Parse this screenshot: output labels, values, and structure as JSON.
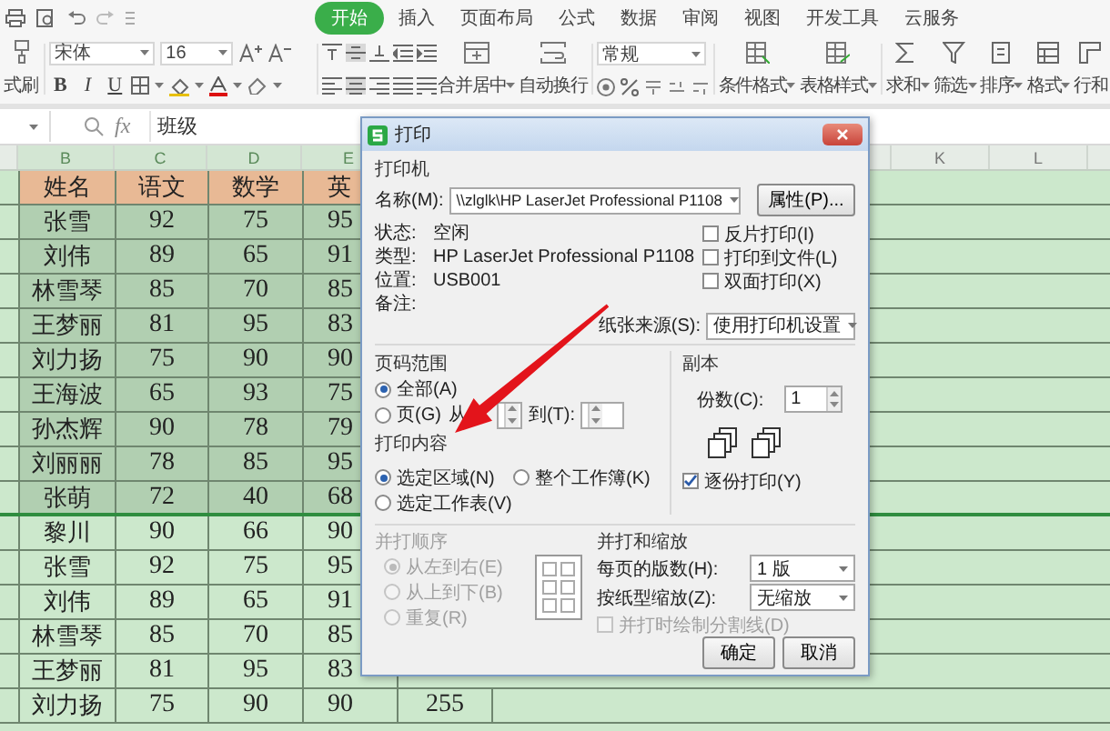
{
  "ribbon": {
    "tabs": [
      {
        "label": "开始",
        "selected": true
      },
      {
        "label": "插入",
        "selected": false
      },
      {
        "label": "页面布局",
        "selected": false
      },
      {
        "label": "公式",
        "selected": false
      },
      {
        "label": "数据",
        "selected": false
      },
      {
        "label": "审阅",
        "selected": false
      },
      {
        "label": "视图",
        "selected": false
      },
      {
        "label": "开发工具",
        "selected": false
      },
      {
        "label": "云服务",
        "selected": false
      }
    ],
    "format_painter": "式刷",
    "font_name": "宋体",
    "font_size": "16",
    "text_styles": [
      "B",
      "I",
      "U"
    ],
    "merge": "合并居中",
    "wrap": "自动换行",
    "number_format": "常规",
    "commands": [
      {
        "label": "条件格式",
        "menu": true
      },
      {
        "label": "表格样式",
        "menu": true
      },
      {
        "label": "求和",
        "menu": true
      },
      {
        "label": "筛选",
        "menu": true
      },
      {
        "label": "排序",
        "menu": true
      },
      {
        "label": "格式",
        "menu": true
      },
      {
        "label": "行和",
        "menu": false
      }
    ]
  },
  "formula_bar": {
    "fx": "fx",
    "value": "班级"
  },
  "sheet": {
    "columns_left": [
      "B",
      "C",
      "D",
      "E"
    ],
    "columns_right": [
      "K",
      "L"
    ],
    "rows": [
      {
        "kind": "header",
        "cells": [
          "姓名",
          "语文",
          "数学",
          "英"
        ]
      },
      {
        "kind": "data",
        "selected": true,
        "cells": [
          "张雪",
          "92",
          "75",
          "95"
        ]
      },
      {
        "kind": "data",
        "selected": true,
        "cells": [
          "刘伟",
          "89",
          "65",
          "91"
        ]
      },
      {
        "kind": "data",
        "selected": true,
        "cells": [
          "林雪琴",
          "85",
          "70",
          "85"
        ]
      },
      {
        "kind": "data",
        "selected": true,
        "cells": [
          "王梦丽",
          "81",
          "95",
          "83"
        ]
      },
      {
        "kind": "data",
        "selected": true,
        "cells": [
          "刘力扬",
          "75",
          "90",
          "90"
        ]
      },
      {
        "kind": "data",
        "selected": true,
        "cells": [
          "王海波",
          "65",
          "93",
          "75"
        ]
      },
      {
        "kind": "data",
        "selected": true,
        "cells": [
          "孙杰辉",
          "90",
          "78",
          "79"
        ]
      },
      {
        "kind": "data",
        "selected": true,
        "cells": [
          "刘丽丽",
          "78",
          "85",
          "95"
        ]
      },
      {
        "kind": "data",
        "selected": true,
        "cells": [
          "张萌",
          "72",
          "40",
          "68"
        ]
      },
      {
        "kind": "data",
        "selected": false,
        "cells": [
          "黎川",
          "90",
          "66",
          "90"
        ]
      },
      {
        "kind": "data",
        "selected": false,
        "cells": [
          "张雪",
          "92",
          "75",
          "95"
        ]
      },
      {
        "kind": "data",
        "selected": false,
        "cells": [
          "刘伟",
          "89",
          "65",
          "91"
        ]
      },
      {
        "kind": "data",
        "selected": false,
        "cells": [
          "林雪琴",
          "85",
          "70",
          "85"
        ]
      },
      {
        "kind": "data",
        "selected": false,
        "cells": [
          "王梦丽",
          "81",
          "95",
          "83"
        ]
      },
      {
        "kind": "data",
        "selected": false,
        "cells": [
          "刘力扬",
          "75",
          "90",
          "90",
          "255"
        ]
      }
    ]
  },
  "print_dialog": {
    "title": "打印",
    "printer": {
      "heading": "打印机",
      "name_label": "名称(M):",
      "name_value": "\\\\zlglk\\HP LaserJet Professional P1108",
      "properties_button": "属性(P)...",
      "info": [
        {
          "label": "状态:",
          "value": "空闲"
        },
        {
          "label": "类型:",
          "value": "HP LaserJet Professional P1108"
        },
        {
          "label": "位置:",
          "value": "USB001"
        },
        {
          "label": "备注:"
        }
      ],
      "options": [
        {
          "label": "反片打印(I)",
          "checked": false
        },
        {
          "label": "打印到文件(L)",
          "checked": false
        },
        {
          "label": "双面打印(X)",
          "checked": false
        }
      ],
      "paper_source": {
        "label": "纸张来源(S):",
        "value": "使用打印机设置"
      }
    },
    "page_range": {
      "heading": "页码范围",
      "options": [
        {
          "label": "全部(A)",
          "selected": true
        },
        {
          "label": "页(G)",
          "selected": false
        }
      ],
      "from_label": "从",
      "to_label": "到(T):"
    },
    "copies": {
      "heading": "副本",
      "count_label": "份数(C):",
      "count": "1",
      "collate": {
        "label": "逐份打印(Y)",
        "checked": true
      }
    },
    "print_what": {
      "heading": "打印内容",
      "options": [
        {
          "label": "选定区域(N)",
          "selected": true
        },
        {
          "label": "整个工作簿(K)",
          "selected": false
        },
        {
          "label": "选定工作表(V)",
          "selected": false
        }
      ]
    },
    "order": {
      "heading": "并打顺序",
      "disabled": true,
      "options": [
        {
          "label": "从左到右(E)",
          "selected": true
        },
        {
          "label": "从上到下(B)",
          "selected": false
        },
        {
          "label": "重复(R)",
          "selected": false
        }
      ]
    },
    "scaling": {
      "heading": "并打和缩放",
      "pages_label": "每页的版数(H):",
      "pages_value": "1 版",
      "scale_label": "按纸型缩放(Z):",
      "scale_value": "无缩放",
      "divider_option": {
        "label": "并打时绘制分割线(D)",
        "checked": false,
        "disabled": true
      }
    },
    "buttons": [
      "确定",
      "取消"
    ]
  }
}
